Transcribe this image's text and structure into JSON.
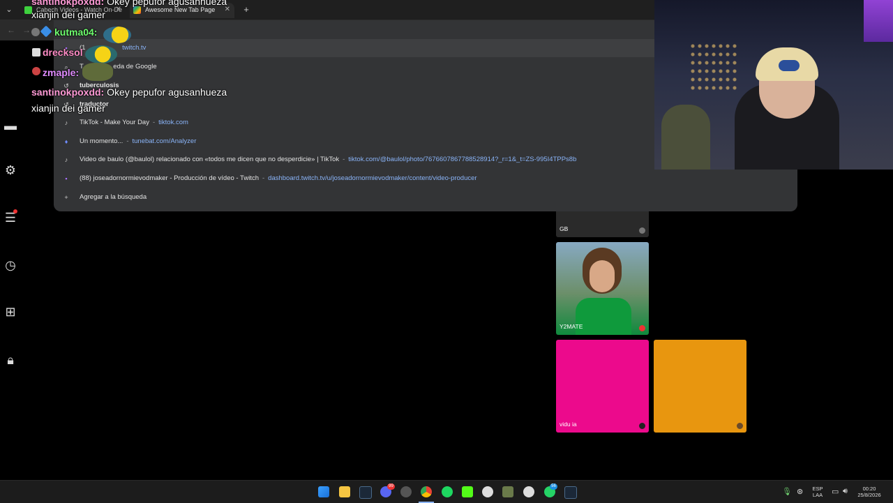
{
  "browser": {
    "tabs": [
      {
        "title": "Cabech Videos - Watch On-De"
      },
      {
        "title": "Awesome New Tab Page"
      }
    ]
  },
  "omnibox": {
    "rows": [
      {
        "icon": "twitch-icon",
        "title": "(1",
        "url": "twitch.tv"
      },
      {
        "icon": "search-icon",
        "title": "T",
        "suffix": "eda de Google"
      },
      {
        "icon": "history-icon",
        "title": "tuberculosis"
      },
      {
        "icon": "history-icon",
        "title": "traductor"
      },
      {
        "icon": "tiktok-icon",
        "title": "TikTok - Make Your Day",
        "url": "tiktok.com"
      },
      {
        "icon": "tunebat-icon",
        "title": "Un momento...",
        "url": "tunebat.com/Analyzer"
      },
      {
        "icon": "tiktok-icon",
        "title": "Video de baulo (@baulol) relacionado con «todos me dicen que no desperdicie» | TikTok",
        "url": "tiktok.com/@baulol/photo/7676607867788528914?_r=1&_t=ZS-995I4TPPs8b"
      },
      {
        "icon": "twitch-icon",
        "title": "(88) joseadornormievodmaker - Producción de vídeo - Twitch",
        "url": "dashboard.twitch.tv/u/joseadornormievodmaker/content/video-producer"
      },
      {
        "icon": "plus-icon",
        "title": "Agregar a la búsqueda"
      }
    ]
  },
  "chat": [
    {
      "user": "santinokpoxdd:",
      "message": "Okey pepufor agusanhueza",
      "color": "#ff9ad6"
    },
    {
      "user": "",
      "message": "xianjin dei gamer",
      "color": "#ffffff"
    },
    {
      "user": "kutma04:",
      "message": "",
      "color": "#6fff6f"
    },
    {
      "user": "drecksol",
      "message": "",
      "color": "#ff8cc6"
    },
    {
      "user": "zmaple:",
      "message": "",
      "color": "#e08cff"
    },
    {
      "user": "santinokpoxdd:",
      "message": "Okey pepufor agusanhueza",
      "color": "#ff9ad6"
    },
    {
      "user": "",
      "message": "xianjin dei gamer",
      "color": "#ffffff"
    }
  ],
  "tiles": [
    {
      "label": "GB",
      "color": "#2a2a2a"
    },
    {
      "label": "Y2MATE",
      "color": "#7aa3b8"
    },
    {
      "label": "vidu ia",
      "color": "#ec0a8c"
    },
    {
      "label": "",
      "color": "#e8960f"
    }
  ],
  "tray": {
    "lang_line1": "ESP",
    "lang_line2": "LAA",
    "time": "00:20",
    "date": "25/8/2026"
  },
  "taskbar_badges": {
    "discord": "99",
    "whatsapp": "56"
  }
}
